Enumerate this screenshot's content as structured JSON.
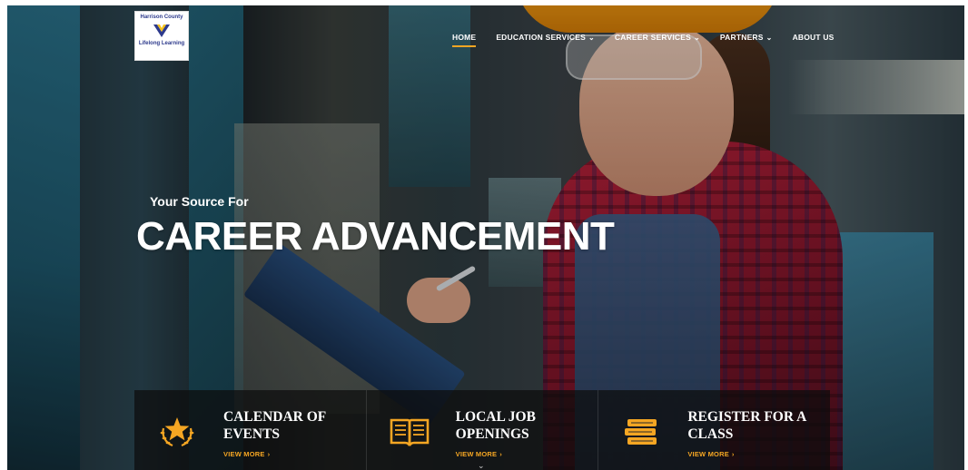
{
  "logo": {
    "line1": "Harrison County",
    "line2": "Lifelong Learning"
  },
  "nav": {
    "items": [
      {
        "label": "HOME",
        "dropdown": false,
        "active": true
      },
      {
        "label": "EDUCATION SERVICES",
        "dropdown": true,
        "active": false
      },
      {
        "label": "CAREER SERVICES",
        "dropdown": true,
        "active": false
      },
      {
        "label": "PARTNERS",
        "dropdown": true,
        "active": false
      },
      {
        "label": "ABOUT US",
        "dropdown": false,
        "active": false
      }
    ],
    "dropdown_icon": "chevron-down-icon"
  },
  "hero": {
    "eyebrow": "Your Source For",
    "headline": "CAREER ADVANCEMENT"
  },
  "cards": [
    {
      "title_line1": "CALENDAR OF",
      "title_line2": "EVENTS",
      "link": "VIEW MORE",
      "icon": "star-wreath-icon"
    },
    {
      "title_line1": "LOCAL JOB",
      "title_line2": "OPENINGS",
      "link": "VIEW MORE",
      "icon": "open-book-icon"
    },
    {
      "title_line1": "REGISTER FOR A",
      "title_line2": "CLASS",
      "link": "VIEW MORE",
      "icon": "book-stack-icon"
    }
  ],
  "colors": {
    "accent": "#f5a623",
    "text": "#ffffff",
    "card_bg": "#0c0c0c"
  }
}
